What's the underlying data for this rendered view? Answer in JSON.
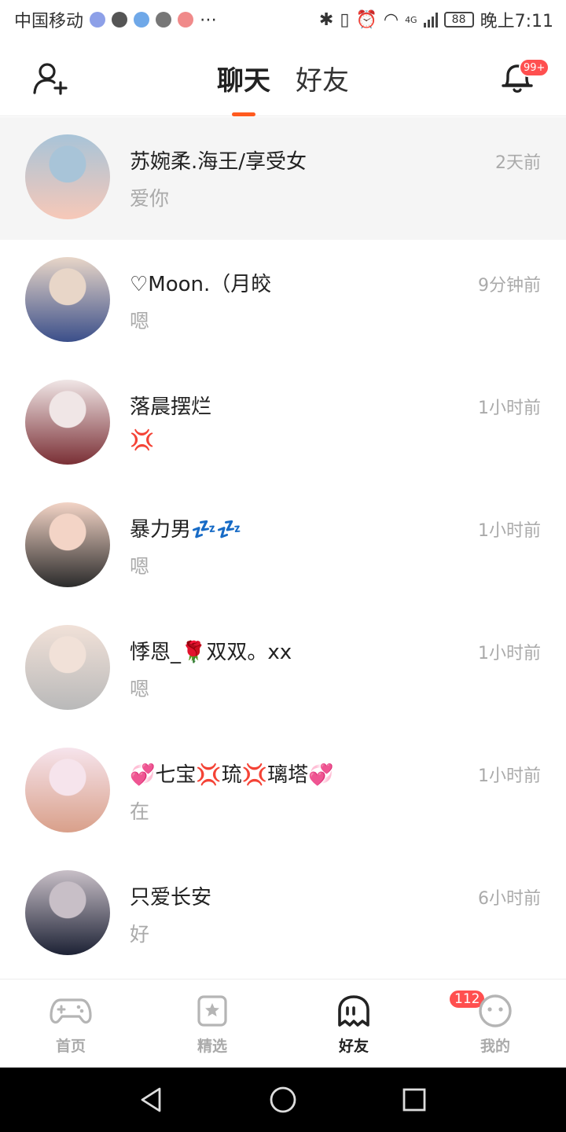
{
  "status_bar": {
    "carrier": "中国移动",
    "network": "4G",
    "battery": "88",
    "time": "晚上7:11"
  },
  "header": {
    "tabs": [
      {
        "label": "聊天",
        "active": true
      },
      {
        "label": "好友",
        "active": false
      }
    ],
    "notification_badge": "99+",
    "accent_color": "#ff5a1f",
    "badge_color": "#ff4f4f"
  },
  "chats": [
    {
      "name": "苏婉柔.海王/享受女",
      "message": "爱你",
      "time": "2天前",
      "highlighted": true,
      "avatar_colors": [
        "#f7c8b8",
        "#a8c4d8"
      ]
    },
    {
      "name": "♡Moon.（月皎",
      "message": "嗯",
      "time": "9分钟前",
      "highlighted": false,
      "avatar_colors": [
        "#3b4f8a",
        "#e8d6c8"
      ]
    },
    {
      "name": "落晨摆烂",
      "message": "💢",
      "time": "1小时前",
      "highlighted": false,
      "avatar_colors": [
        "#7a2f35",
        "#f0e6e6"
      ]
    },
    {
      "name": "暴力男💤💤",
      "message": "嗯",
      "time": "1小时前",
      "highlighted": false,
      "avatar_colors": [
        "#2b2b2b",
        "#f3d4c6"
      ]
    },
    {
      "name": "悸恩_🌹双双。xx",
      "message": "嗯",
      "time": "1小时前",
      "highlighted": false,
      "avatar_colors": [
        "#b9b9b9",
        "#f1e1d8"
      ]
    },
    {
      "name": "💞七宝💢琉💢璃塔💞",
      "message": "在",
      "time": "1小时前",
      "highlighted": false,
      "avatar_colors": [
        "#d9a08a",
        "#f6e4ec"
      ]
    },
    {
      "name": "只爱长安",
      "message": "好",
      "time": "6小时前",
      "highlighted": false,
      "avatar_colors": [
        "#1d2235",
        "#c8bfc7"
      ]
    }
  ],
  "bottom_nav": {
    "items": [
      {
        "label": "首页",
        "icon": "gamepad-icon",
        "active": false
      },
      {
        "label": "精选",
        "icon": "star-bookmark-icon",
        "active": false
      },
      {
        "label": "好友",
        "icon": "ghost-icon",
        "active": true,
        "badge": "112"
      },
      {
        "label": "我的",
        "icon": "face-icon",
        "active": false
      }
    ]
  },
  "system_nav": [
    "back-icon",
    "home-icon",
    "recents-icon"
  ]
}
